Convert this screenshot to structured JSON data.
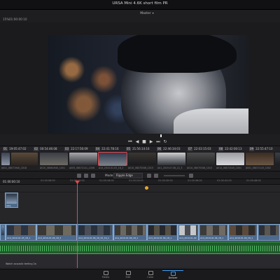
{
  "window": {
    "title": "URSA Mini 4.6K short film PR"
  },
  "viewer": {
    "selector": "Master",
    "zoom": "15%",
    "timecode": "01:00:00:10"
  },
  "clips": [
    {
      "num": "01",
      "tc": "19:05:47:02"
    },
    {
      "num": "02",
      "tc": "00:54:46:08"
    },
    {
      "num": "03",
      "tc": "22:17:56:09"
    },
    {
      "num": "04",
      "tc": "22:41:78:16"
    },
    {
      "num": "05",
      "tc": "21:56:14:16"
    },
    {
      "num": "06",
      "tc": "22:46:34:03"
    },
    {
      "num": "07",
      "tc": "22:03:15:03"
    },
    {
      "num": "08",
      "tc": "22:42:00:13"
    },
    {
      "num": "09",
      "tc": "22:55:47:10"
    }
  ],
  "thumb_labels": [
    "A001_08071940_C018",
    "A010_08061940_C001",
    "A005_08072141_C006",
    "A14_2010.01.03_18_2",
    "A010_08070346_C015",
    "A01_2019.07.08_22_3",
    "A010_08070348_C010",
    "A014_08072045_C001",
    "A001_08072143_C002",
    "A003_08072121_C004"
  ],
  "toolbar": {
    "mode_label": "Mode:",
    "mode_value": "Ripple Edge"
  },
  "timeline": {
    "timecode": "01:00:00:10",
    "ruler": [
      "01:00:06:00",
      "01:00:12:00",
      "01:00:18:00",
      "01:00:24:00",
      "01:00:30:00",
      "01:00:36:00",
      "01:00:42:00",
      "01:00:48:00",
      "01:00:54:00"
    ],
    "v2_label": "A04_",
    "v1_labels": [
      "A14_2010.01.03_18_1",
      "A14_2019.01.09_18_3",
      "A14_2019.01.06_18_34_19_1",
      "A14_2019.01.06_18_1",
      "A14_2019.01.09_18_1",
      "A14_2019.01.09",
      "A14_2019.01.06_18_1",
      "A14_2019.01.09_18_1"
    ],
    "audio_label": "Watch acoustic teeling 2a"
  },
  "pages": [
    {
      "label": "Media",
      "active": false
    },
    {
      "label": "Edit",
      "active": false
    },
    {
      "label": "Color",
      "active": false
    },
    {
      "label": "Deliver",
      "active": true
    }
  ]
}
